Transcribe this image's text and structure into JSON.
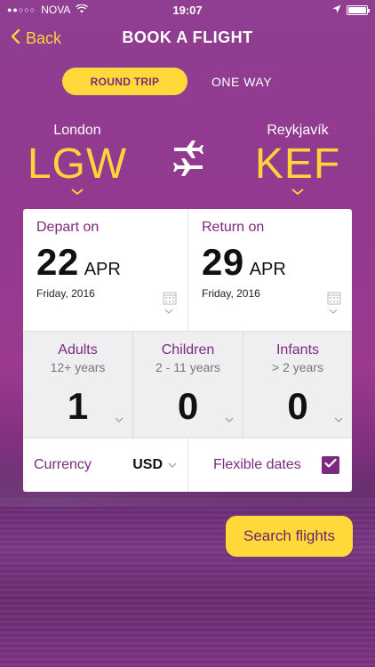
{
  "status_bar": {
    "carrier": "NOVA",
    "time": "19:07"
  },
  "nav": {
    "back_label": "Back",
    "title": "BOOK A FLIGHT"
  },
  "trip_type": {
    "round_trip": "ROUND TRIP",
    "one_way": "ONE WAY",
    "selected": "round_trip"
  },
  "route": {
    "from": {
      "city": "London",
      "code": "LGW"
    },
    "to": {
      "city": "Reykjavík",
      "code": "KEF"
    }
  },
  "dates": {
    "depart": {
      "label": "Depart on",
      "day": "22",
      "month": "APR",
      "sub": "Friday, 2016"
    },
    "return": {
      "label": "Return on",
      "day": "29",
      "month": "APR",
      "sub": "Friday, 2016"
    }
  },
  "passengers": [
    {
      "label": "Adults",
      "sub": "12+ years",
      "count": "1"
    },
    {
      "label": "Children",
      "sub": "2 - 11 years",
      "count": "0"
    },
    {
      "label": "Infants",
      "sub": "> 2 years",
      "count": "0"
    }
  ],
  "options": {
    "currency_label": "Currency",
    "currency_value": "USD",
    "flexible_label": "Flexible dates",
    "flexible_checked": true
  },
  "search_button": "Search flights",
  "colors": {
    "accent_yellow": "#ffd93a",
    "brand_purple": "#7c2a7f"
  },
  "icons": [
    "back-chevron-icon",
    "swap-planes-icon",
    "calendar-icon",
    "chevron-down-icon",
    "checkmark-icon",
    "wifi-icon",
    "location-arrow-icon",
    "battery-icon"
  ]
}
